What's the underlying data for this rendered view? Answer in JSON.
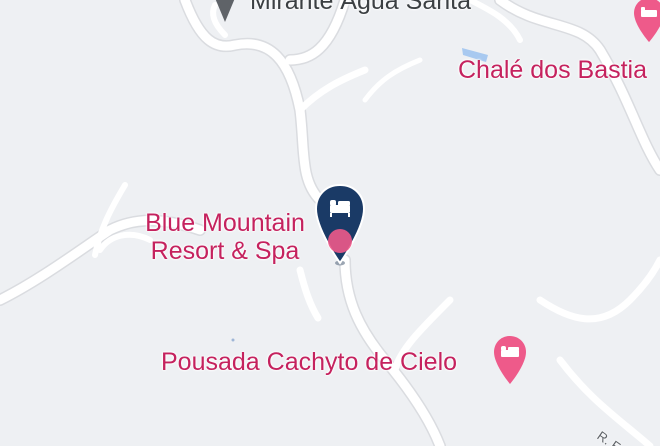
{
  "map": {
    "background": "#eef0f3",
    "road_color": "#ffffff",
    "accent": "#c5225e",
    "selected_pin_color": "#1a3a66"
  },
  "places": {
    "mirante": {
      "label": "Mirante Água Santa",
      "icon": "viewpoint-icon"
    },
    "chale": {
      "label": "Chalé dos Bastia",
      "icon": "hotel-icon"
    },
    "blue_mountain": {
      "line1": "Blue Mountain",
      "line2": "Resort & Spa",
      "icon": "hotel-icon",
      "selected": true
    },
    "pousada": {
      "label": "Pousada Cachyto de Cielo",
      "icon": "hotel-icon"
    }
  },
  "streets": {
    "r_label": "R. Fr"
  }
}
